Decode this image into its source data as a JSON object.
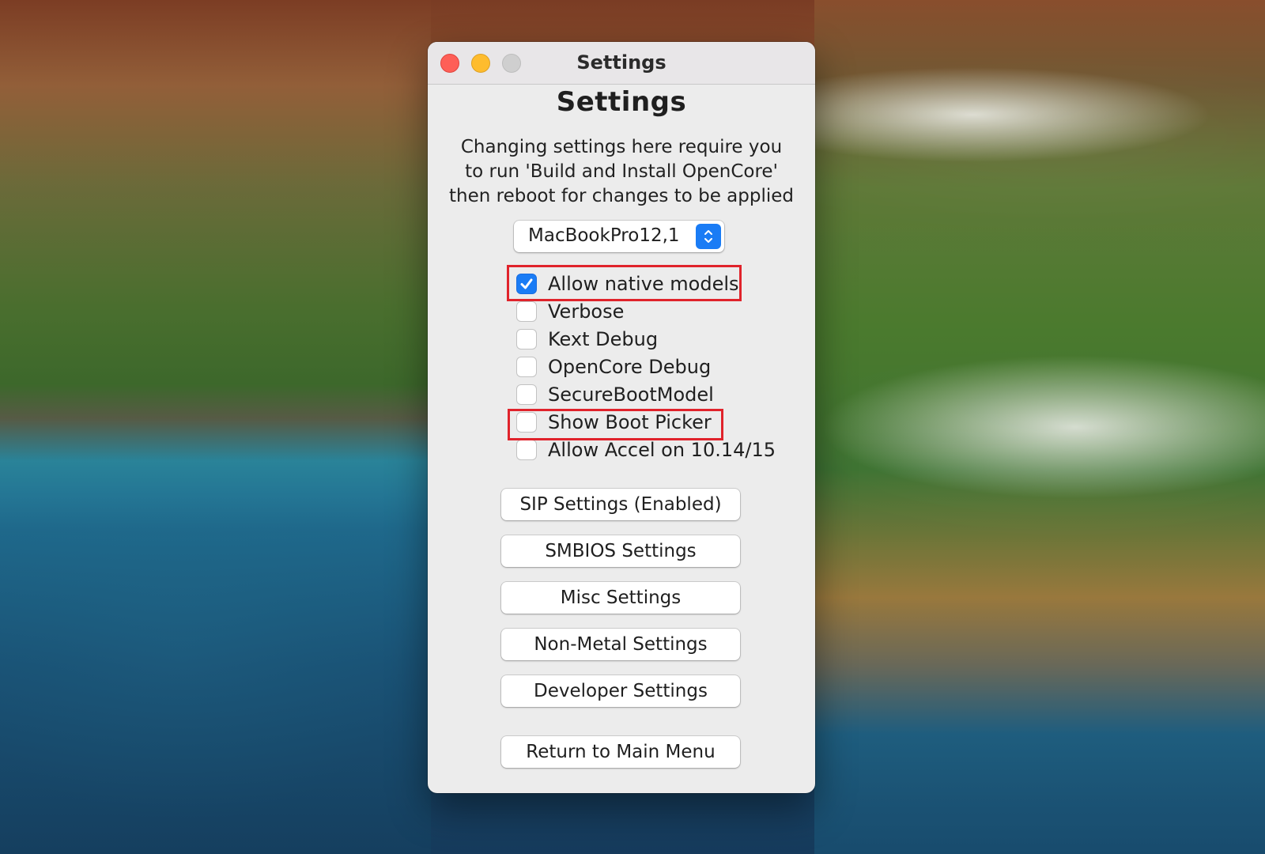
{
  "window": {
    "title": "Settings"
  },
  "main": {
    "heading": "Settings",
    "description_lines": [
      "Changing settings here require you",
      "to run 'Build and Install OpenCore'",
      "then reboot for changes to be applied"
    ],
    "model_select": {
      "value": "MacBookPro12,1"
    },
    "checkboxes": [
      {
        "label": "Allow native models",
        "checked": true
      },
      {
        "label": "Verbose",
        "checked": false
      },
      {
        "label": "Kext Debug",
        "checked": false
      },
      {
        "label": "OpenCore Debug",
        "checked": false
      },
      {
        "label": "SecureBootModel",
        "checked": false
      },
      {
        "label": "Show Boot Picker",
        "checked": false
      },
      {
        "label": "Allow Accel on 10.14/15",
        "checked": false
      }
    ],
    "buttons": {
      "sip": "SIP Settings (Enabled)",
      "smbios": "SMBIOS Settings",
      "misc": "Misc Settings",
      "non_metal": "Non-Metal Settings",
      "developer": "Developer Settings",
      "return": "Return to Main Menu"
    }
  },
  "colors": {
    "accent": "#1a7cf5",
    "highlight": "#e0232b"
  }
}
